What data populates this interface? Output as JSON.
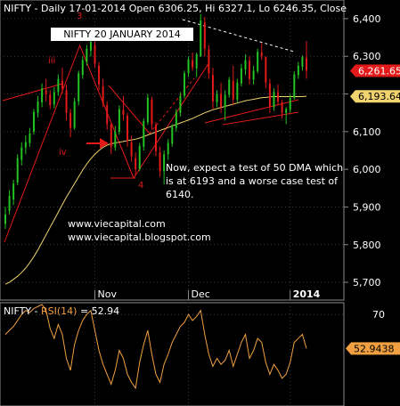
{
  "header": {
    "symbol": "NIFTY",
    "text": " - Daily 17-01-2014 Open 6306.25, Hi 6327.1, Lo 6246.35, Close"
  },
  "title_box": "NIFTY 20 JANUARY 2014",
  "annotations": {
    "comment_lines": [
      "Now, expect a test of 50 DMA which",
      "is at 6193 and a worse case test of",
      "6140."
    ],
    "links": [
      "www.viecapital.com",
      "www.viecapital.blogspot.com"
    ],
    "wave_labels": [
      "3",
      "iii",
      "iv",
      "4"
    ]
  },
  "price_panel": {
    "ylim": [
      5660,
      6440
    ],
    "ticks": [
      "6,400",
      "6,300",
      "6,200",
      "6,100",
      "6,000",
      "5,900",
      "5,800",
      "5,700"
    ],
    "tick_values": [
      6400,
      6300,
      6200,
      6100,
      6000,
      5900,
      5800,
      5700
    ],
    "last_price": "6,261.65",
    "last_price_value": 6261.65,
    "dma_label": "6,193.64",
    "dma_value": 6193.64,
    "months": [
      "Nov",
      "Dec",
      "2014"
    ],
    "month_bars": [
      22,
      45,
      70
    ],
    "colors": {
      "up": "#22c322",
      "down": "#e31a1a",
      "dma": "#f0d26e",
      "annotation": "#e31a1a",
      "trend_dashed": "#ffffff"
    }
  },
  "rsi_panel": {
    "label_prefix": "NIFTY - ",
    "label_name": "RSI(14)",
    "label_value": " = 52.94",
    "ylim": [
      25,
      75
    ],
    "tick": "70",
    "tick_value": 70,
    "last_value": "52.9438",
    "color": "#f0a040"
  },
  "chart_data": {
    "type": "candlestick",
    "series": [
      {
        "name": "NIFTY",
        "values": [
          [
            5855,
            5900,
            5842,
            5880
          ],
          [
            5890,
            5945,
            5880,
            5930
          ],
          [
            5920,
            5972,
            5905,
            5962
          ],
          [
            5965,
            6040,
            5958,
            6030
          ],
          [
            6025,
            6072,
            6010,
            6058
          ],
          [
            6058,
            6090,
            6040,
            6072
          ],
          [
            6070,
            6110,
            6060,
            6095
          ],
          [
            6100,
            6160,
            6092,
            6152
          ],
          [
            6150,
            6195,
            6138,
            6180
          ],
          [
            6178,
            6228,
            6165,
            6215
          ],
          [
            6210,
            6240,
            6180,
            6200
          ],
          [
            6198,
            6210,
            6160,
            6170
          ],
          [
            6172,
            6218,
            6162,
            6205
          ],
          [
            6205,
            6252,
            6195,
            6240
          ],
          [
            6235,
            6270,
            6200,
            6215
          ],
          [
            6210,
            6225,
            6130,
            6150
          ],
          [
            6150,
            6160,
            6085,
            6110
          ],
          [
            6110,
            6190,
            6105,
            6180
          ],
          [
            6180,
            6262,
            6170,
            6255
          ],
          [
            6250,
            6300,
            6240,
            6290
          ],
          [
            6285,
            6330,
            6275,
            6320
          ],
          [
            6315,
            6345,
            6300,
            6338
          ],
          [
            6330,
            6340,
            6270,
            6280
          ],
          [
            6275,
            6285,
            6210,
            6225
          ],
          [
            6220,
            6240,
            6165,
            6175
          ],
          [
            6170,
            6180,
            6105,
            6120
          ],
          [
            6118,
            6125,
            6040,
            6060
          ],
          [
            6058,
            6115,
            6050,
            6100
          ],
          [
            6100,
            6170,
            6092,
            6160
          ],
          [
            6158,
            6195,
            6130,
            6145
          ],
          [
            6142,
            6150,
            6060,
            6075
          ],
          [
            6072,
            6090,
            6020,
            6035
          ],
          [
            6030,
            6045,
            5985,
            6000
          ],
          [
            6000,
            6070,
            5995,
            6062
          ],
          [
            6060,
            6135,
            6050,
            6128
          ],
          [
            6125,
            6200,
            6118,
            6190
          ],
          [
            6185,
            6192,
            6105,
            6120
          ],
          [
            6118,
            6125,
            6035,
            6048
          ],
          [
            6045,
            6060,
            5980,
            5995
          ],
          [
            5995,
            6050,
            5960,
            6040
          ],
          [
            6040,
            6080,
            6025,
            6070
          ],
          [
            6068,
            6120,
            6060,
            6112
          ],
          [
            6110,
            6160,
            6100,
            6152
          ],
          [
            6150,
            6205,
            6140,
            6195
          ],
          [
            6195,
            6262,
            6188,
            6255
          ],
          [
            6255,
            6300,
            6245,
            6292
          ],
          [
            6290,
            6310,
            6262,
            6270
          ],
          [
            6268,
            6310,
            6245,
            6305
          ],
          [
            6300,
            6412,
            6298,
            6395
          ],
          [
            6390,
            6405,
            6300,
            6320
          ],
          [
            6318,
            6330,
            6240,
            6255
          ],
          [
            6250,
            6270,
            6160,
            6180
          ],
          [
            6178,
            6210,
            6165,
            6200
          ],
          [
            6200,
            6230,
            6150,
            6165
          ],
          [
            6165,
            6210,
            6130,
            6198
          ],
          [
            6198,
            6245,
            6190,
            6238
          ],
          [
            6235,
            6275,
            6170,
            6185
          ],
          [
            6185,
            6240,
            6178,
            6230
          ],
          [
            6228,
            6280,
            6220,
            6268
          ],
          [
            6265,
            6305,
            6250,
            6290
          ],
          [
            6288,
            6300,
            6225,
            6240
          ],
          [
            6238,
            6275,
            6225,
            6262
          ],
          [
            6260,
            6320,
            6255,
            6312
          ],
          [
            6310,
            6335,
            6290,
            6300
          ],
          [
            6298,
            6300,
            6215,
            6230
          ],
          [
            6228,
            6240,
            6150,
            6165
          ],
          [
            6165,
            6215,
            6155,
            6205
          ],
          [
            6205,
            6225,
            6170,
            6180
          ],
          [
            6178,
            6185,
            6135,
            6150
          ],
          [
            6150,
            6165,
            6120,
            6160
          ],
          [
            6158,
            6200,
            6150,
            6190
          ],
          [
            6190,
            6260,
            6185,
            6252
          ],
          [
            6250,
            6285,
            6240,
            6275
          ],
          [
            6272,
            6302,
            6262,
            6298
          ],
          [
            6296,
            6340,
            6240,
            6262
          ]
        ]
      },
      {
        "name": "50 DMA",
        "values": [
          5695,
          5700,
          5708,
          5716,
          5726,
          5738,
          5752,
          5768,
          5786,
          5806,
          5826,
          5846,
          5866,
          5886,
          5906,
          5926,
          5944,
          5962,
          5980,
          5998,
          6014,
          6028,
          6040,
          6050,
          6058,
          6064,
          6068,
          6070,
          6072,
          6074,
          6076,
          6078,
          6080,
          6083,
          6087,
          6091,
          6095,
          6099,
          6103,
          6107,
          6111,
          6115,
          6119,
          6123,
          6127,
          6131,
          6135,
          6140,
          6145,
          6150,
          6154,
          6158,
          6161,
          6164,
          6167,
          6170,
          6173,
          6176,
          6179,
          6182,
          6184,
          6186,
          6188,
          6190,
          6191,
          6192,
          6193,
          6193,
          6193,
          6193,
          6193,
          6193,
          6193,
          6193,
          6194
        ]
      },
      {
        "name": "RSI(14)",
        "values": [
          60,
          62,
          64,
          67,
          70,
          72,
          71,
          73,
          74,
          75,
          72,
          63,
          58,
          65,
          60,
          48,
          42,
          55,
          62,
          67,
          70,
          72,
          62,
          52,
          45,
          40,
          35,
          42,
          52,
          48,
          40,
          36,
          33,
          46,
          55,
          62,
          50,
          40,
          36,
          45,
          50,
          56,
          60,
          64,
          66,
          70,
          67,
          69,
          72,
          60,
          50,
          44,
          48,
          45,
          47,
          52,
          44,
          50,
          56,
          60,
          48,
          52,
          58,
          56,
          46,
          40,
          45,
          42,
          38,
          40,
          46,
          56,
          58,
          60,
          52.94
        ]
      }
    ]
  }
}
